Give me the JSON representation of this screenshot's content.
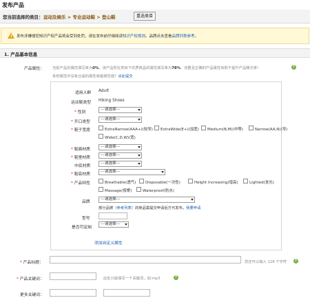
{
  "page": {
    "title": "发布产品"
  },
  "category": {
    "label": "您当前选择的类目：",
    "path": "运动及娱乐 > 专业运动鞋 > 登山鞋",
    "reselect_label": "重选类目"
  },
  "warning": {
    "text": "发布涉嫌侵犯知识产权产品将会受到处罚，请在发布前仔细阅读",
    "link1": "知识产权规则",
    "mid": "。品牌点击查看",
    "link2": "品牌列表参考",
    "end": "。"
  },
  "section": {
    "title": "1. 产品基本信息"
  },
  "attributes": {
    "label": "产品属性：",
    "note_line1_a": "当前产品的属性填写率为",
    "rate_current": "0%",
    "note_line1_b": "，该产品所在类目下优质商品的属性填写率为",
    "rate_good": "78%",
    "note_line1_c": "，完整且正确的产品属性有助于提升产品曝光率!",
    "note_line2": "系统属性中没有合适的属性或者属性值？",
    "note_link": "点此提交",
    "rows": {
      "target": {
        "label": "适用人群",
        "value": "Adult"
      },
      "sport": {
        "label": "运动鞋类型",
        "value": "Hiking Shoes"
      },
      "gender": {
        "label": "性别",
        "select": "---请选择---"
      },
      "opening": {
        "label": "开口类型",
        "select": "---请选择---"
      },
      "width": {
        "label": "鞋子宽度",
        "options": [
          "ExtraNarrow(AAA+)(较窄)",
          "ExtraWide(E+)(加宽)",
          "Medium(B,M)(中等)",
          "Narrow(AA,N)(窄)",
          "Wide(C,D,W)(宽)"
        ]
      },
      "upper": {
        "label": "鞋面材质",
        "select": "---请选择---"
      },
      "lining": {
        "label": "鞋里材质",
        "select": "---请选择---"
      },
      "midsole": {
        "label": "中底材质",
        "select": "---请选择---"
      },
      "outsole": {
        "label": "鞋底材质",
        "select": "---请选择---"
      },
      "features": {
        "label": "产品特性",
        "options": [
          "Breathable(透气)",
          "Disposable(一次性)",
          "Height Increasing(增高)",
          "Lighted(发光)",
          "Massage(按摩)",
          "Waterproof(防水)"
        ]
      },
      "brand": {
        "label": "品牌",
        "select": "---请选择---",
        "note_a": "部分品牌（",
        "note_link": "参考列表",
        "note_b": "）的商品需提交申请后方可发布。",
        "apply_link": "我要申请"
      },
      "model": {
        "label": "型号"
      },
      "custom": {
        "label": "是否可定制",
        "select": "---请选择---"
      }
    },
    "add_custom": "添加自定义属性"
  },
  "fields": {
    "product_title": {
      "label": "产品标题：",
      "hint": "您还可以输入 128 个字符"
    },
    "keyword": {
      "label": "产品关键词：",
      "hint": "此处只能填写一个关键词，如:mp3"
    },
    "more_keywords": {
      "label": "更多关键词："
    }
  },
  "colors": {
    "accent_link": "#1a5fb4",
    "warning_bg": "#fff9d8",
    "category_path": "#8a5a14",
    "required": "#e33333"
  }
}
